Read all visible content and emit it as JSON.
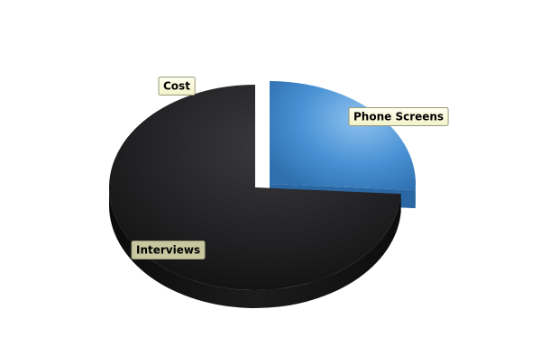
{
  "chart_data": {
    "type": "pie",
    "title": "",
    "subtitle": "",
    "categories": [
      "Phone Screens",
      "Interviews"
    ],
    "values": [
      26,
      74
    ],
    "percent_unit": "%",
    "series": [
      {
        "name": "Cost",
        "values": [
          26,
          74
        ]
      }
    ],
    "label_text": {
      "series_name": "Cost",
      "phone_screens": "Phone Screens",
      "interviews": "Interviews"
    },
    "colors": {
      "phone_screens": "#3d86c8",
      "interviews": "#1a1a1a",
      "label_bg_light": "#fbfbd6",
      "label_bg_dark": "#c8c7a0",
      "label_border": "#9a9a7a",
      "label_text": "#000000"
    },
    "legend": "none",
    "three_d": true,
    "exploded_slice": "Phone Screens",
    "grid": false
  }
}
